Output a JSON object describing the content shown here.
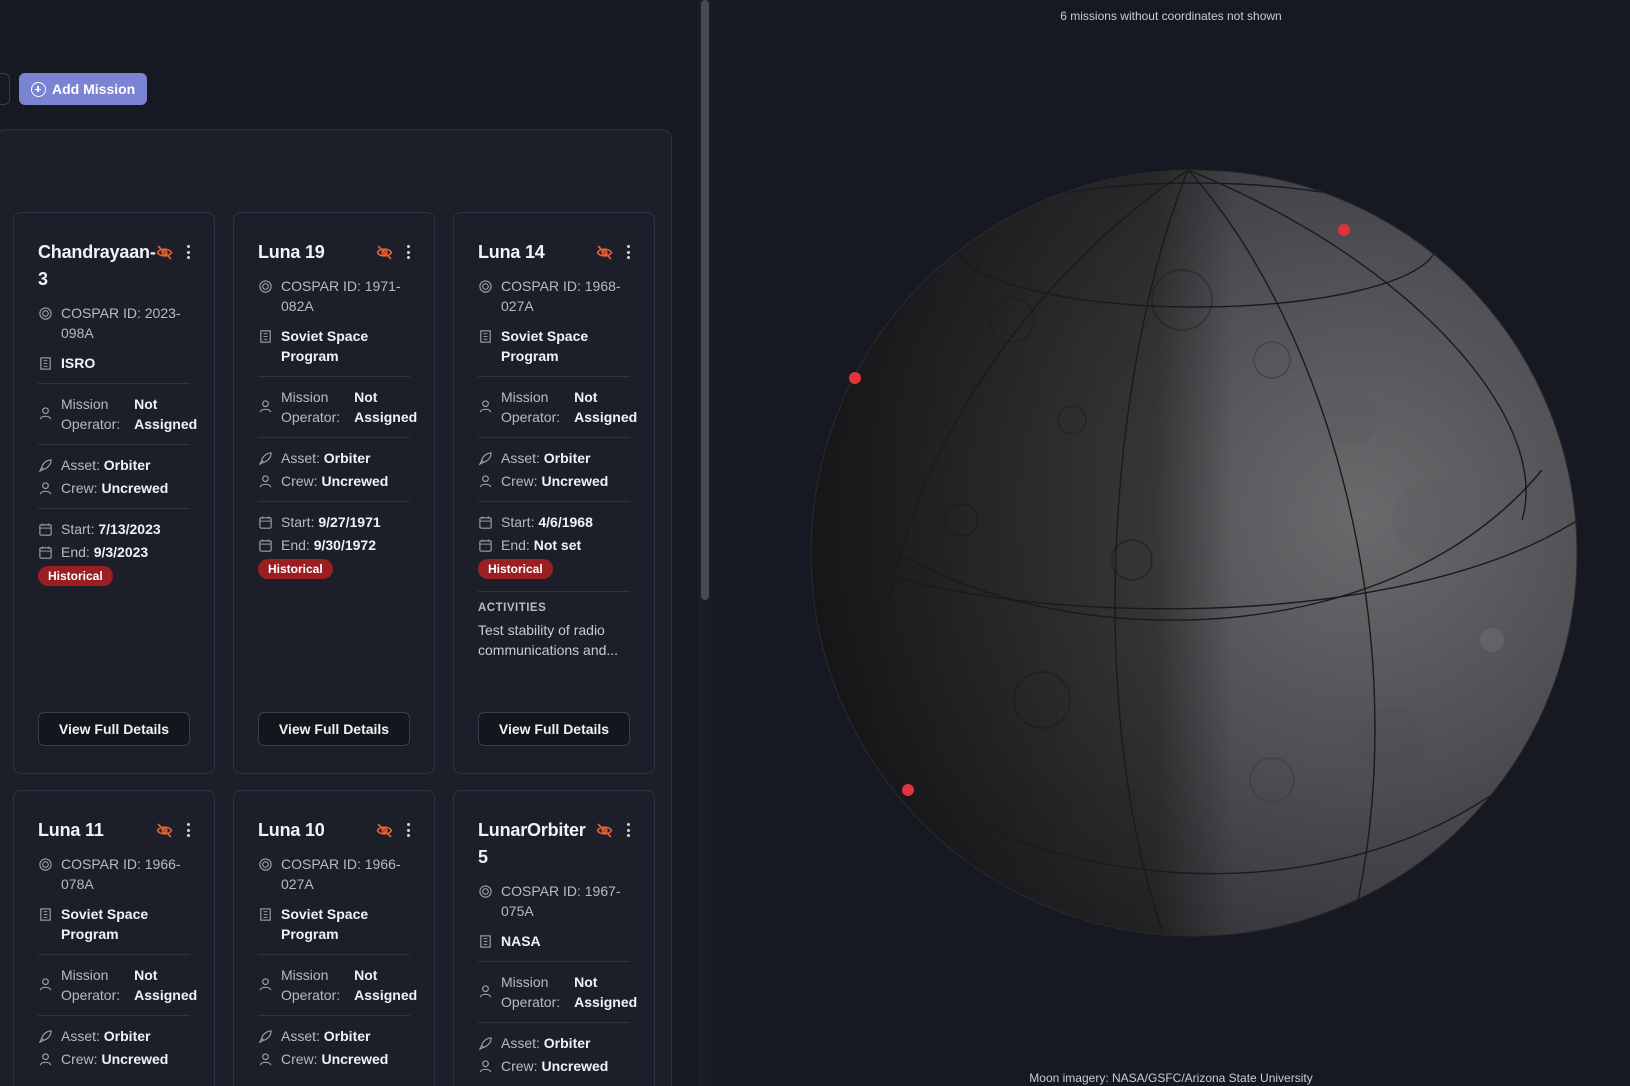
{
  "toolbar": {
    "add_mission_label": "Add Mission"
  },
  "labels": {
    "cospar_prefix": "COSPAR ID:",
    "mission_operator_a": "Mission",
    "mission_operator_b": "Operator:",
    "asset": "Asset:",
    "crew": "Crew:",
    "start": "Start:",
    "end": "End:",
    "activities": "ACTIVITIES",
    "view_details": "View Full Details"
  },
  "missions": [
    {
      "title_a": "Chandrayaan-",
      "title_b": "3",
      "cospar_a": "COSPAR ID: 2023-",
      "cospar_b": "098A",
      "agency_a": "ISRO",
      "agency_b": "",
      "operator_a": "Not",
      "operator_b": "Assigned",
      "asset": "Orbiter",
      "crew": "Uncrewed",
      "start": "7/13/2023",
      "end": "9/3/2023",
      "badge": "Historical",
      "activities": ""
    },
    {
      "title_a": "Luna 19",
      "title_b": "",
      "cospar_a": "COSPAR ID: 1971-",
      "cospar_b": "082A",
      "agency_a": "Soviet Space",
      "agency_b": "Program",
      "operator_a": "Not",
      "operator_b": "Assigned",
      "asset": "Orbiter",
      "crew": "Uncrewed",
      "start": "9/27/1971",
      "end": "9/30/1972",
      "badge": "Historical",
      "activities": ""
    },
    {
      "title_a": "Luna 14",
      "title_b": "",
      "cospar_a": "COSPAR ID: 1968-",
      "cospar_b": "027A",
      "agency_a": "Soviet Space",
      "agency_b": "Program",
      "operator_a": "Not",
      "operator_b": "Assigned",
      "asset": "Orbiter",
      "crew": "Uncrewed",
      "start": "4/6/1968",
      "end": "Not set",
      "badge": "Historical",
      "activities_a": "Test stability of radio",
      "activities_b": "communications and..."
    },
    {
      "title_a": "Luna 11",
      "title_b": "",
      "cospar_a": "COSPAR ID: 1966-",
      "cospar_b": "078A",
      "agency_a": "Soviet Space",
      "agency_b": "Program",
      "operator_a": "Not",
      "operator_b": "Assigned",
      "asset": "Orbiter",
      "crew": "Uncrewed"
    },
    {
      "title_a": "Luna 10",
      "title_b": "",
      "cospar_a": "COSPAR ID: 1966-",
      "cospar_b": "027A",
      "agency_a": "Soviet Space",
      "agency_b": "Program",
      "operator_a": "Not",
      "operator_b": "Assigned",
      "asset": "Orbiter",
      "crew": "Uncrewed"
    },
    {
      "title_a": "LunarOrbiter",
      "title_b": "5",
      "cospar_a": "COSPAR ID: 1967-",
      "cospar_b": "075A",
      "agency_a": "NASA",
      "agency_b": "",
      "operator_a": "Not",
      "operator_b": "Assigned",
      "asset": "Orbiter",
      "crew": "Uncrewed"
    }
  ],
  "map": {
    "note": "6 missions without coordinates not shown",
    "credit": "Moon imagery: NASA/GSFC/Arizona State University",
    "marker_color": "#e0343d"
  },
  "colors": {
    "accent": "#7b83d3",
    "badge": "#9a1e22",
    "hidden_icon": "#e0633a"
  }
}
